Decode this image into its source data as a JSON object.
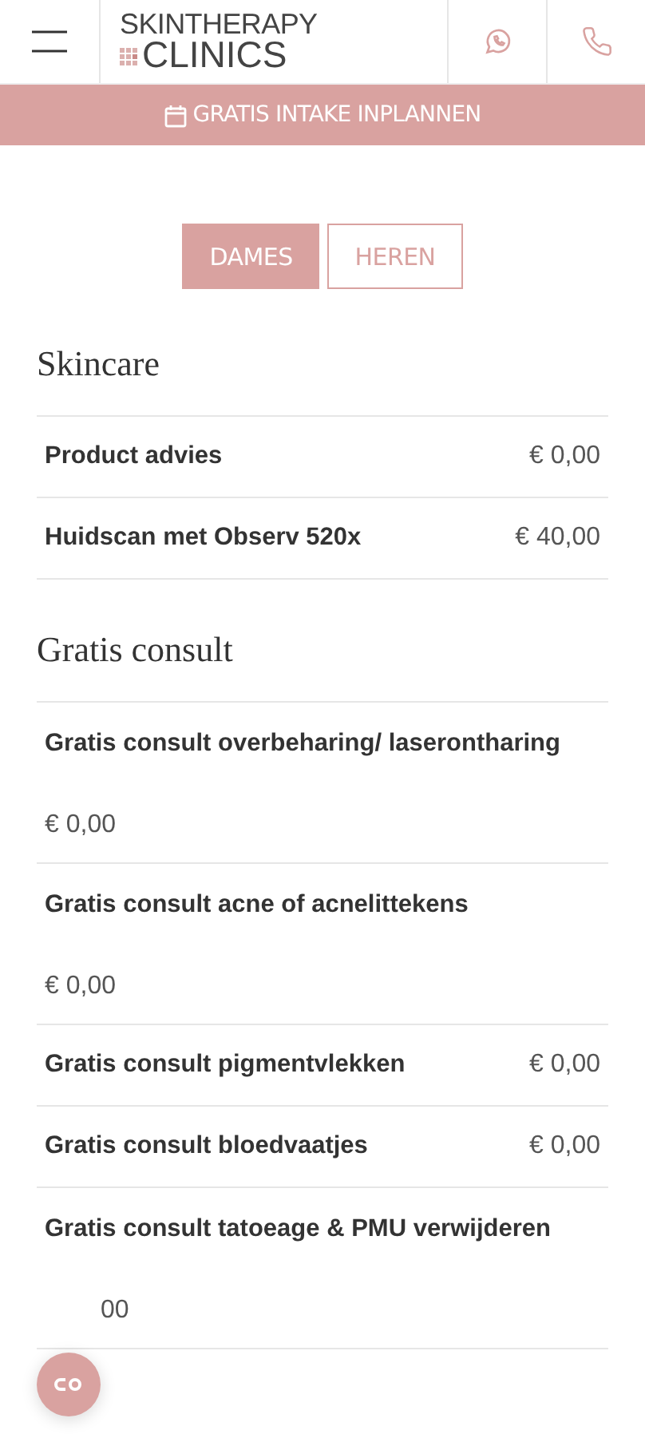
{
  "header": {
    "logo_top": "SKINTHERAPY",
    "logo_bottom": "CLINICS"
  },
  "banner": {
    "label": "GRATIS INTAKE INPLANNEN"
  },
  "tabs": [
    {
      "label": "DAMES",
      "selected": true
    },
    {
      "label": "HEREN",
      "selected": false
    }
  ],
  "sections": [
    {
      "title": "Skincare",
      "items": [
        {
          "kind": "inline",
          "name": "Product advies",
          "price": "€ 0,00"
        },
        {
          "kind": "inline",
          "name": "Huidscan met Observ 520x",
          "price": "€ 40,00"
        }
      ]
    },
    {
      "title": "Gratis consult",
      "items": [
        {
          "kind": "stacked",
          "name": "Gratis consult overbeharing/ laserontharing",
          "price": "€ 0,00"
        },
        {
          "kind": "stacked",
          "name": "Gratis consult acne of acnelittekens",
          "price": "€ 0,00"
        },
        {
          "kind": "inline",
          "name": "Gratis consult pigmentvlekken",
          "price": "€ 0,00"
        },
        {
          "kind": "inline",
          "name": "Gratis consult bloedvaatjes",
          "price": "€ 0,00"
        },
        {
          "kind": "stacked",
          "name": "Gratis consult tatoeage & PMU verwijderen",
          "price": "00",
          "covered": true
        }
      ]
    }
  ]
}
